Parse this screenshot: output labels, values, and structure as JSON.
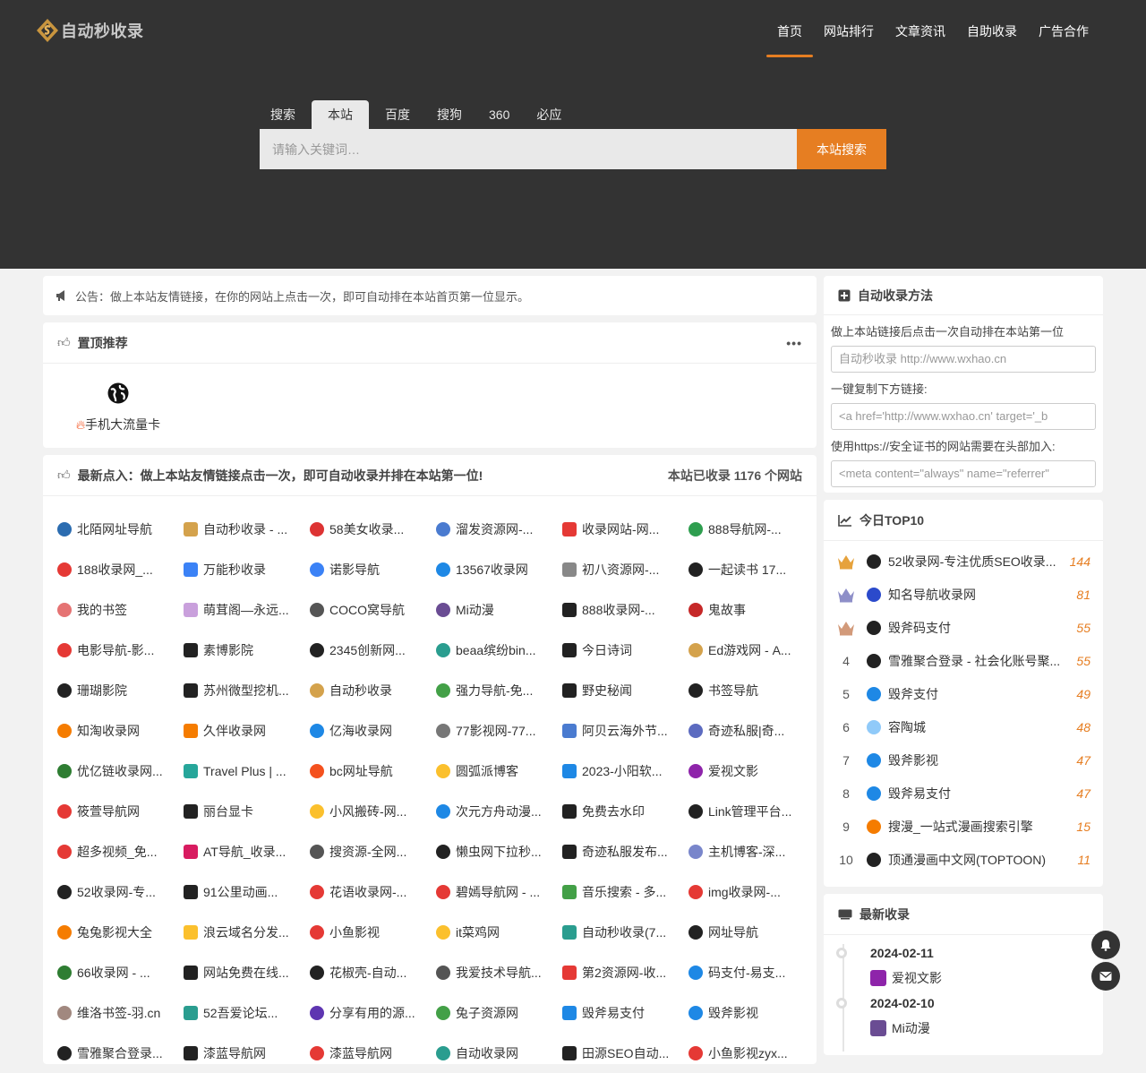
{
  "brand": {
    "name": "自动秒收录"
  },
  "nav": [
    {
      "label": "首页",
      "active": true
    },
    {
      "label": "网站排行"
    },
    {
      "label": "文章资讯"
    },
    {
      "label": "自助收录"
    },
    {
      "label": "广告合作"
    }
  ],
  "search": {
    "tabs": [
      "搜索",
      "本站",
      "百度",
      "搜狗",
      "360",
      "必应"
    ],
    "active_tab": "本站",
    "placeholder": "请输入关键词…",
    "button": "本站搜索"
  },
  "notice": "公告：做上本站友情链接，在你的网站上点击一次，即可自动排在本站首页第一位显示。",
  "top_recommend": {
    "title": "置顶推荐",
    "more": "•••",
    "sites": [
      {
        "name": "手机大流量卡"
      }
    ]
  },
  "latest_in": {
    "title": "最新点入：做上本站友情链接点击一次，即可自动收录并排在本站第一位!",
    "count": "本站已收录 1176 个网站",
    "sites": [
      {
        "name": "北陌网址导航",
        "color": "#2b6cb0"
      },
      {
        "name": "自动秒收录 - ...",
        "color": "#d4a24c"
      },
      {
        "name": "58美女收录...",
        "color": "#d33"
      },
      {
        "name": "溜发资源网-...",
        "color": "#4a7bd0"
      },
      {
        "name": "收录网站-网...",
        "color": "#e53935"
      },
      {
        "name": "888导航网-...",
        "color": "#2e9e4f"
      },
      {
        "name": "188收录网_...",
        "color": "#e53935"
      },
      {
        "name": "万能秒收录",
        "color": "#3b82f6"
      },
      {
        "name": "诺影导航",
        "color": "#3b82f6"
      },
      {
        "name": "13567收录网",
        "color": "#1e88e5"
      },
      {
        "name": "初八资源网-...",
        "color": "#888"
      },
      {
        "name": "一起读书 17...",
        "color": "#222"
      },
      {
        "name": "我的书签",
        "color": "#e57373"
      },
      {
        "name": "萌茸阁—永远...",
        "color": "#c9a0dc"
      },
      {
        "name": "COCO窝导航",
        "color": "#555"
      },
      {
        "name": "Mi动漫",
        "color": "#6a4c93"
      },
      {
        "name": "888收录网-...",
        "color": "#222"
      },
      {
        "name": "鬼故事",
        "color": "#c62828"
      },
      {
        "name": "电影导航-影...",
        "color": "#e53935"
      },
      {
        "name": "素博影院",
        "color": "#222"
      },
      {
        "name": "2345创新网...",
        "color": "#222"
      },
      {
        "name": "beaa缤纷bin...",
        "color": "#2a9d8f"
      },
      {
        "name": "今日诗词",
        "color": "#222"
      },
      {
        "name": "Ed游戏网 - A...",
        "color": "#d4a24c"
      },
      {
        "name": "珊瑚影院",
        "color": "#222"
      },
      {
        "name": "苏州微型挖机...",
        "color": "#222"
      },
      {
        "name": "自动秒收录",
        "color": "#d4a24c"
      },
      {
        "name": "强力导航-免...",
        "color": "#43a047"
      },
      {
        "name": "野史秘闻",
        "color": "#222"
      },
      {
        "name": "书签导航",
        "color": "#222"
      },
      {
        "name": "知淘收录网",
        "color": "#f57c00"
      },
      {
        "name": "久伴收录网",
        "color": "#f57c00"
      },
      {
        "name": "亿海收录网",
        "color": "#1e88e5"
      },
      {
        "name": "77影视网-77...",
        "color": "#777"
      },
      {
        "name": "阿贝云海外节...",
        "color": "#4a7bd0"
      },
      {
        "name": "奇迹私服|奇...",
        "color": "#5c6bc0"
      },
      {
        "name": "优亿链收录网...",
        "color": "#2e7d32"
      },
      {
        "name": "Travel Plus | ...",
        "color": "#26a69a"
      },
      {
        "name": "bc网址导航",
        "color": "#f4511e"
      },
      {
        "name": "圆弧派博客",
        "color": "#fbc02d"
      },
      {
        "name": "2023-小阳软...",
        "color": "#1e88e5"
      },
      {
        "name": "爱视文影",
        "color": "#8e24aa"
      },
      {
        "name": "筱萱导航网",
        "color": "#e53935"
      },
      {
        "name": "丽台显卡",
        "color": "#222"
      },
      {
        "name": "小风搬砖-网...",
        "color": "#fbc02d"
      },
      {
        "name": "次元方舟动漫...",
        "color": "#1e88e5"
      },
      {
        "name": "免费去水印",
        "color": "#222"
      },
      {
        "name": "Link管理平台...",
        "color": "#222"
      },
      {
        "name": "超多视频_免...",
        "color": "#e53935"
      },
      {
        "name": "AT导航_收录...",
        "color": "#d81b60"
      },
      {
        "name": "搜资源-全网...",
        "color": "#555"
      },
      {
        "name": "懒虫网下拉秒...",
        "color": "#222"
      },
      {
        "name": "奇迹私服发布...",
        "color": "#222"
      },
      {
        "name": "主机博客-深...",
        "color": "#7986cb"
      },
      {
        "name": "52收录网-专...",
        "color": "#222"
      },
      {
        "name": "91公里动画...",
        "color": "#222"
      },
      {
        "name": "花语收录网-...",
        "color": "#e53935"
      },
      {
        "name": "碧嫣导航网 - ...",
        "color": "#e53935"
      },
      {
        "name": "音乐搜索 - 多...",
        "color": "#43a047"
      },
      {
        "name": "img收录网-...",
        "color": "#e53935"
      },
      {
        "name": "兔兔影视大全",
        "color": "#f57c00"
      },
      {
        "name": "浪云域名分发...",
        "color": "#fbc02d"
      },
      {
        "name": "小鱼影视",
        "color": "#e53935"
      },
      {
        "name": "it菜鸡网",
        "color": "#fbc02d"
      },
      {
        "name": "自动秒收录(7...",
        "color": "#2a9d8f"
      },
      {
        "name": "网址导航",
        "color": "#222"
      },
      {
        "name": "66收录网 - ...",
        "color": "#2e7d32"
      },
      {
        "name": "网站免费在线...",
        "color": "#222"
      },
      {
        "name": "花椒壳-自动...",
        "color": "#222"
      },
      {
        "name": "我爱技术导航...",
        "color": "#555"
      },
      {
        "name": "第2资源网-收...",
        "color": "#e53935"
      },
      {
        "name": "码支付-易支...",
        "color": "#1e88e5"
      },
      {
        "name": "维洛书签-羽.cn",
        "color": "#a1887f"
      },
      {
        "name": "52吾爱论坛...",
        "color": "#2a9d8f"
      },
      {
        "name": "分享有用的源...",
        "color": "#5e35b1"
      },
      {
        "name": "兔子资源网",
        "color": "#43a047"
      },
      {
        "name": "毁斧易支付",
        "color": "#1e88e5"
      },
      {
        "name": "毁斧影视",
        "color": "#1e88e5"
      },
      {
        "name": "雪雅聚合登录...",
        "color": "#222"
      },
      {
        "name": "漆蓝导航网",
        "color": "#222"
      },
      {
        "name": "漆蓝导航网",
        "color": "#e53935"
      },
      {
        "name": "自动收录网",
        "color": "#2a9d8f"
      },
      {
        "name": "田源SEO自动...",
        "color": "#222"
      },
      {
        "name": "小鱼影视zyx...",
        "color": "#e53935"
      }
    ]
  },
  "method": {
    "title": "自动收录方法",
    "line1": "做上本站链接后点击一次自动排在本站第一位",
    "box1": "自动秒收录 http://www.wxhao.cn",
    "line2": "一键复制下方链接:",
    "box2": "<a href='http://www.wxhao.cn' target='_b",
    "line3": "使用https://安全证书的网站需要在头部加入:",
    "box3": "<meta content=\"always\" name=\"referrer\""
  },
  "top10": {
    "title": "今日TOP10",
    "items": [
      {
        "rank": "1",
        "name": "52收录网-专注优质SEO收录...",
        "hits": "144",
        "color": "#222"
      },
      {
        "rank": "2",
        "name": "知名导航收录网",
        "hits": "81",
        "color": "#2b4acb"
      },
      {
        "rank": "3",
        "name": "毁斧码支付",
        "hits": "55",
        "color": "#222"
      },
      {
        "rank": "4",
        "name": "雪雅聚合登录 - 社会化账号聚...",
        "hits": "55",
        "color": "#222"
      },
      {
        "rank": "5",
        "name": "毁斧支付",
        "hits": "49",
        "color": "#1e88e5"
      },
      {
        "rank": "6",
        "name": "容陶城",
        "hits": "48",
        "color": "#90caf9"
      },
      {
        "rank": "7",
        "name": "毁斧影视",
        "hits": "47",
        "color": "#1e88e5"
      },
      {
        "rank": "8",
        "name": "毁斧易支付",
        "hits": "47",
        "color": "#1e88e5"
      },
      {
        "rank": "9",
        "name": "搜漫_一站式漫画搜索引擎",
        "hits": "15",
        "color": "#f57c00"
      },
      {
        "rank": "10",
        "name": "顶通漫画中文网(TOPTOON)",
        "hits": "11",
        "color": "#222"
      }
    ],
    "crowns": [
      "#e6a23c",
      "#8e8fc8",
      "#d29a7a"
    ]
  },
  "latest": {
    "title": "最新收录",
    "items": [
      {
        "date": "2024-02-11",
        "name": "爱视文影",
        "color": "#8e24aa"
      },
      {
        "date": "2024-02-10",
        "name": "Mi动漫",
        "color": "#6a4c93"
      }
    ]
  }
}
